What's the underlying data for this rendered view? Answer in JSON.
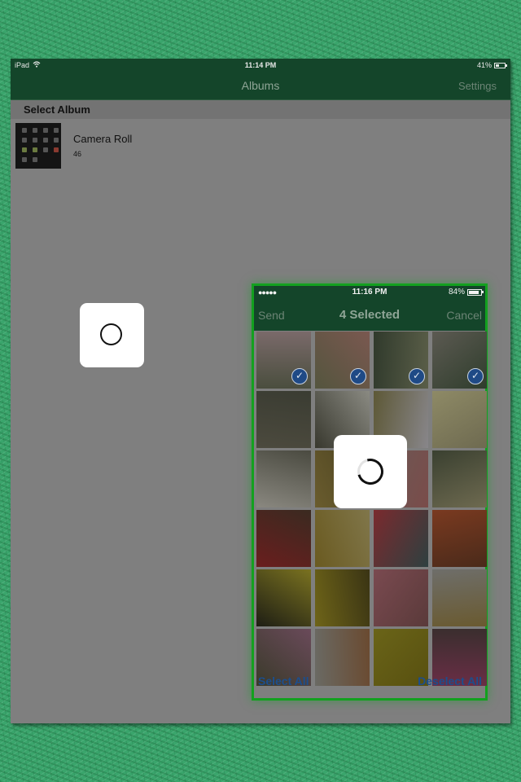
{
  "ipad": {
    "status_bar": {
      "device": "iPad",
      "time": "11:14 PM",
      "battery": "41%",
      "battery_level": 0.41
    },
    "nav": {
      "title": "Albums",
      "settings_label": "Settings"
    },
    "section_header": "Select Album",
    "albums": [
      {
        "name": "Camera Roll",
        "count": "46"
      }
    ],
    "loading": true
  },
  "phone": {
    "status_bar": {
      "signal": "●●●●●",
      "time": "11:16 PM",
      "battery": "84%",
      "battery_level": 0.84
    },
    "nav": {
      "send_label": "Send",
      "title": "4 Selected",
      "cancel_label": "Cancel"
    },
    "photos": [
      {
        "subject": "garden-path-trees",
        "colors": [
          "#4a4e3e",
          "#7a6a6a"
        ],
        "selected": true
      },
      {
        "subject": "garden-trees-flowers",
        "colors": [
          "#54553e",
          "#7a5850"
        ],
        "selected": true
      },
      {
        "subject": "garden-tree-canopy",
        "colors": [
          "#303a2c",
          "#5a5e48"
        ],
        "selected": true
      },
      {
        "subject": "agave-garden",
        "colors": [
          "#5c5a52",
          "#2f3d2c"
        ],
        "selected": true
      },
      {
        "subject": "eucalyptus-tree",
        "colors": [
          "#4c4a3e",
          "#3a3c32"
        ],
        "selected": false
      },
      {
        "subject": "white-flower-beds",
        "colors": [
          "#38382e",
          "#8a8a82"
        ],
        "selected": false
      },
      {
        "subject": "yellow-white-beds",
        "colors": [
          "#5d5836",
          "#88868a"
        ],
        "selected": false
      },
      {
        "subject": "pale-yellow-mums",
        "colors": [
          "#8e8a66",
          "#6e6a50"
        ],
        "selected": false
      },
      {
        "subject": "white-daisies",
        "colors": [
          "#8a8880",
          "#4a4a40"
        ],
        "selected": false
      },
      {
        "subject": "yellow-mums",
        "colors": [
          "#6a5c2e",
          "#4a4220"
        ],
        "selected": false
      },
      {
        "subject": "pink-mums",
        "colors": [
          "#6a5a56",
          "#7a4c4a"
        ],
        "selected": false
      },
      {
        "subject": "garden-trees",
        "colors": [
          "#3a4030",
          "#6e6a50"
        ],
        "selected": false
      },
      {
        "subject": "red-mums",
        "colors": [
          "#6a1e1e",
          "#3a2a20"
        ],
        "selected": false
      },
      {
        "subject": "yellow-mum-bed",
        "colors": [
          "#6a5a20",
          "#80764a"
        ],
        "selected": false
      },
      {
        "subject": "red-spider-mum",
        "colors": [
          "#7a2a2e",
          "#2e4040"
        ],
        "selected": false
      },
      {
        "subject": "orange-spider-mum",
        "colors": [
          "#7a3a20",
          "#4a2a1a"
        ],
        "selected": false
      },
      {
        "subject": "yellow-spider-mum",
        "colors": [
          "#1e1e14",
          "#7a7220"
        ],
        "selected": false
      },
      {
        "subject": "yellow-button-mums",
        "colors": [
          "#6e6418",
          "#3a3414"
        ],
        "selected": false
      },
      {
        "subject": "pink-pompom-mums",
        "colors": [
          "#7a4a50",
          "#5a3a3a"
        ],
        "selected": false
      },
      {
        "subject": "mum-display-building",
        "colors": [
          "#6e6e6a",
          "#6a5a30"
        ],
        "selected": false
      },
      {
        "subject": "multicolor-beds",
        "colors": [
          "#3a3a2a",
          "#6a4a5a"
        ],
        "selected": false
      },
      {
        "subject": "orange-white-mums",
        "colors": [
          "#6a6a64",
          "#6a4a30"
        ],
        "selected": false
      },
      {
        "subject": "yellow-mum-closeup",
        "colors": [
          "#6a6418",
          "#585010"
        ],
        "selected": false
      },
      {
        "subject": "magenta-mums",
        "colors": [
          "#6a2e46",
          "#3a2e2e"
        ],
        "selected": false
      }
    ],
    "bottom": {
      "select_all_label": "Select All",
      "deselect_all_label": "Deselect All"
    },
    "loading": true
  },
  "colors": {
    "bar": "#14452a",
    "frame_green": "#13a01f",
    "link_blue": "#1c4e8d",
    "dim_overlay": "#7f7f7f"
  }
}
